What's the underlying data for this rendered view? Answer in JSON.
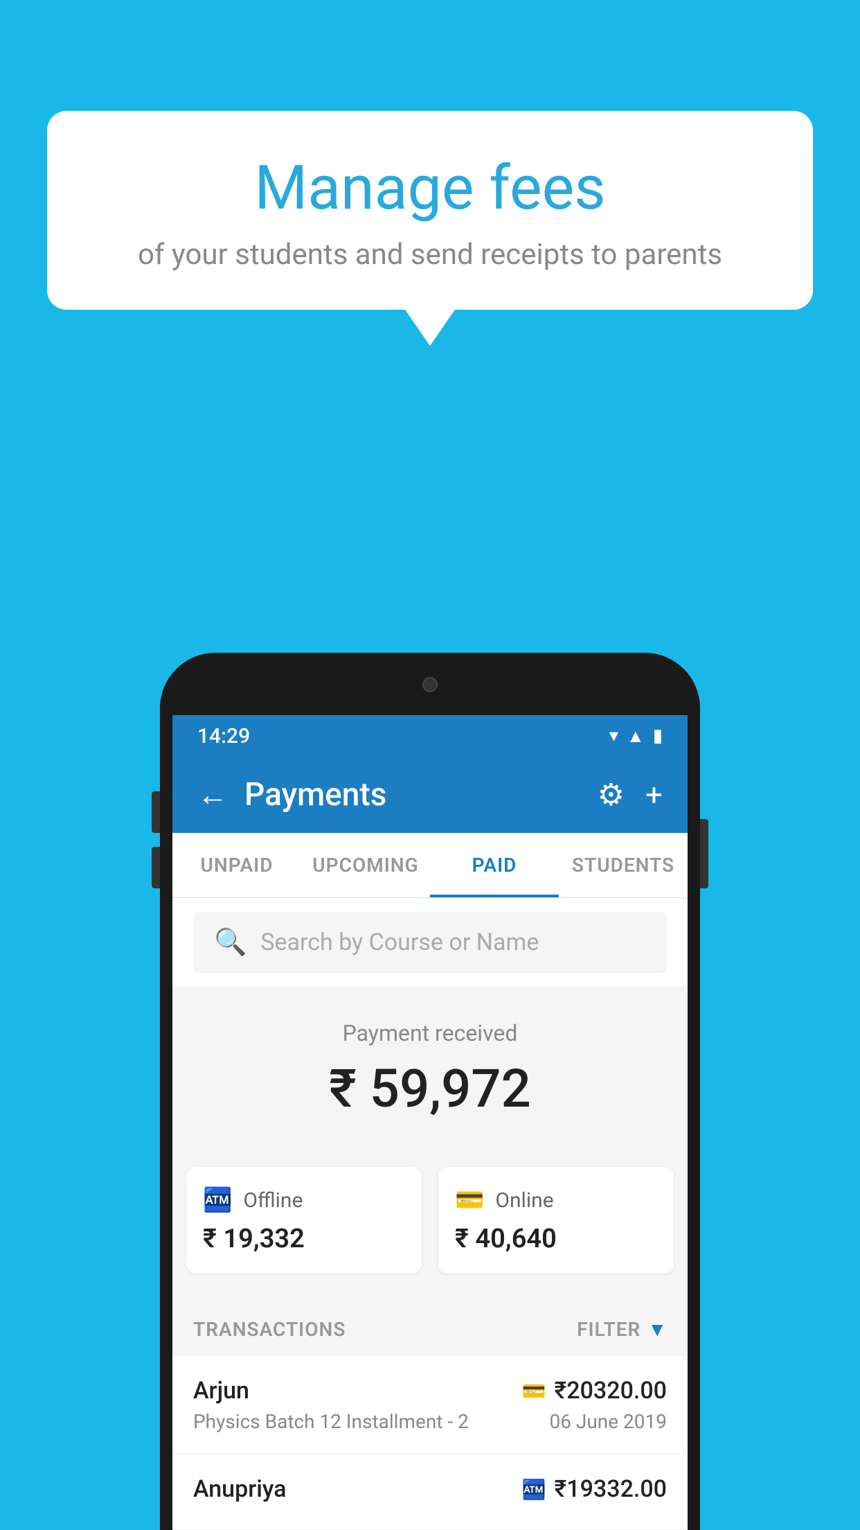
{
  "background_color": "#1ab8e8",
  "bubble": {
    "title": "Manage fees",
    "subtitle": "of your students and send receipts to parents"
  },
  "status_bar": {
    "time": "14:29",
    "icons": [
      "wifi",
      "signal",
      "battery"
    ]
  },
  "header": {
    "title": "Payments",
    "back_label": "←",
    "settings_icon": "⚙",
    "add_icon": "+"
  },
  "tabs": [
    {
      "label": "UNPAID",
      "active": false
    },
    {
      "label": "UPCOMING",
      "active": false
    },
    {
      "label": "PAID",
      "active": true
    },
    {
      "label": "STUDENTS",
      "active": false
    }
  ],
  "search": {
    "placeholder": "Search by Course or Name"
  },
  "payment_summary": {
    "label": "Payment received",
    "amount": "₹ 59,972",
    "offline": {
      "label": "Offline",
      "amount": "₹ 19,332"
    },
    "online": {
      "label": "Online",
      "amount": "₹ 40,640"
    }
  },
  "transactions": {
    "header_label": "TRANSACTIONS",
    "filter_label": "FILTER",
    "rows": [
      {
        "name": "Arjun",
        "course": "Physics Batch 12 Installment - 2",
        "amount": "₹20320.00",
        "date": "06 June 2019",
        "type": "online"
      },
      {
        "name": "Anupriya",
        "course": "",
        "amount": "₹19332.00",
        "date": "",
        "type": "offline"
      }
    ]
  }
}
